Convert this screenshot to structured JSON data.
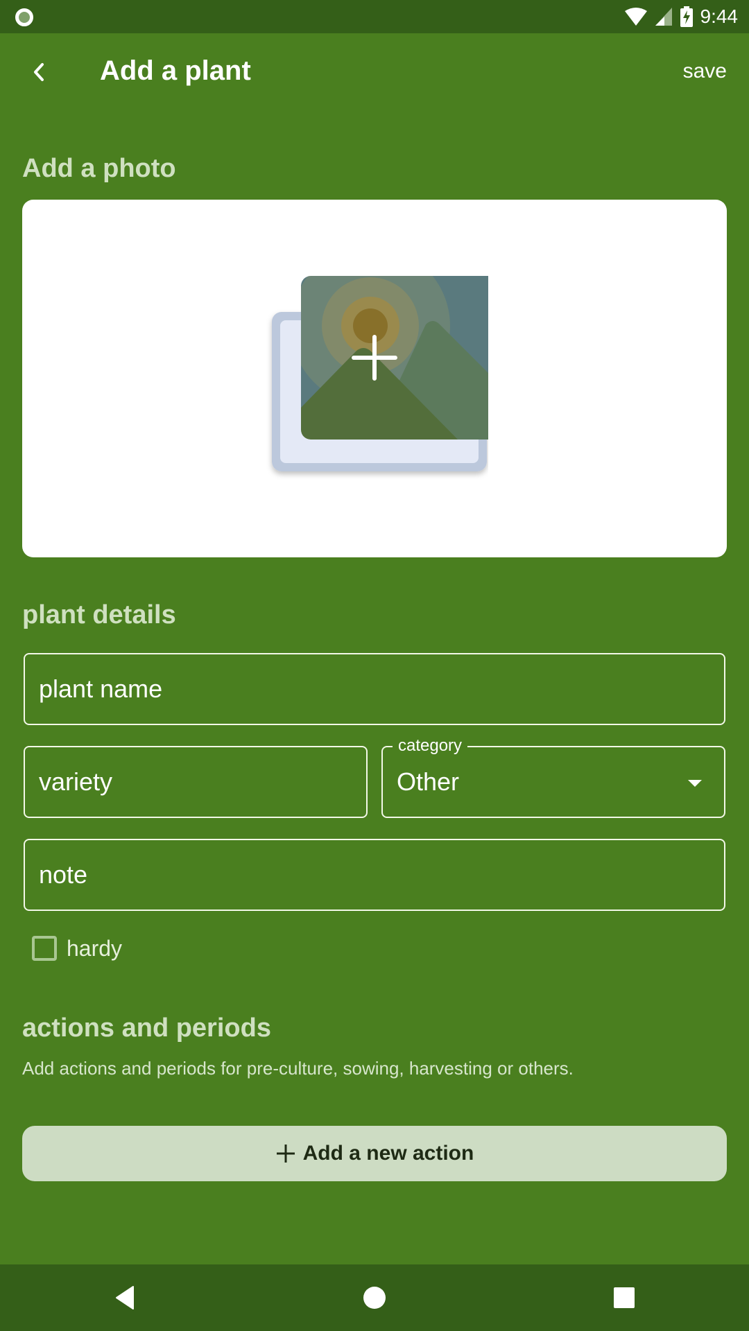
{
  "status_bar": {
    "time": "9:44",
    "icons": [
      "notification-circle-icon",
      "wifi-icon",
      "cellular-signal-icon",
      "battery-charging-icon"
    ]
  },
  "app_bar": {
    "back_icon": "chevron-left-icon",
    "title": "Add a plant",
    "save_label": "save"
  },
  "photo_section": {
    "heading": "Add a photo",
    "icon": "add-photo-icon"
  },
  "details_section": {
    "heading": "plant details",
    "plant_name": {
      "placeholder": "plant name",
      "value": ""
    },
    "variety": {
      "placeholder": "variety",
      "value": ""
    },
    "category": {
      "label": "category",
      "selected": "Other"
    },
    "note": {
      "placeholder": "note",
      "value": ""
    },
    "hardy": {
      "label": "hardy",
      "checked": false
    }
  },
  "actions_section": {
    "heading": "actions and periods",
    "description": "Add actions and periods for pre-culture, sowing, harvesting or others.",
    "add_button_label": "Add a new action",
    "add_icon": "plus-icon"
  },
  "nav_bar": {
    "buttons": [
      "back-triangle-icon",
      "home-circle-icon",
      "recents-square-icon"
    ]
  },
  "colors": {
    "background": "#4a7f1f",
    "status_bar": "#345f18",
    "heading": "#cfe0c0",
    "button_bg": "#cddcc3",
    "button_text": "#1e2a14"
  }
}
